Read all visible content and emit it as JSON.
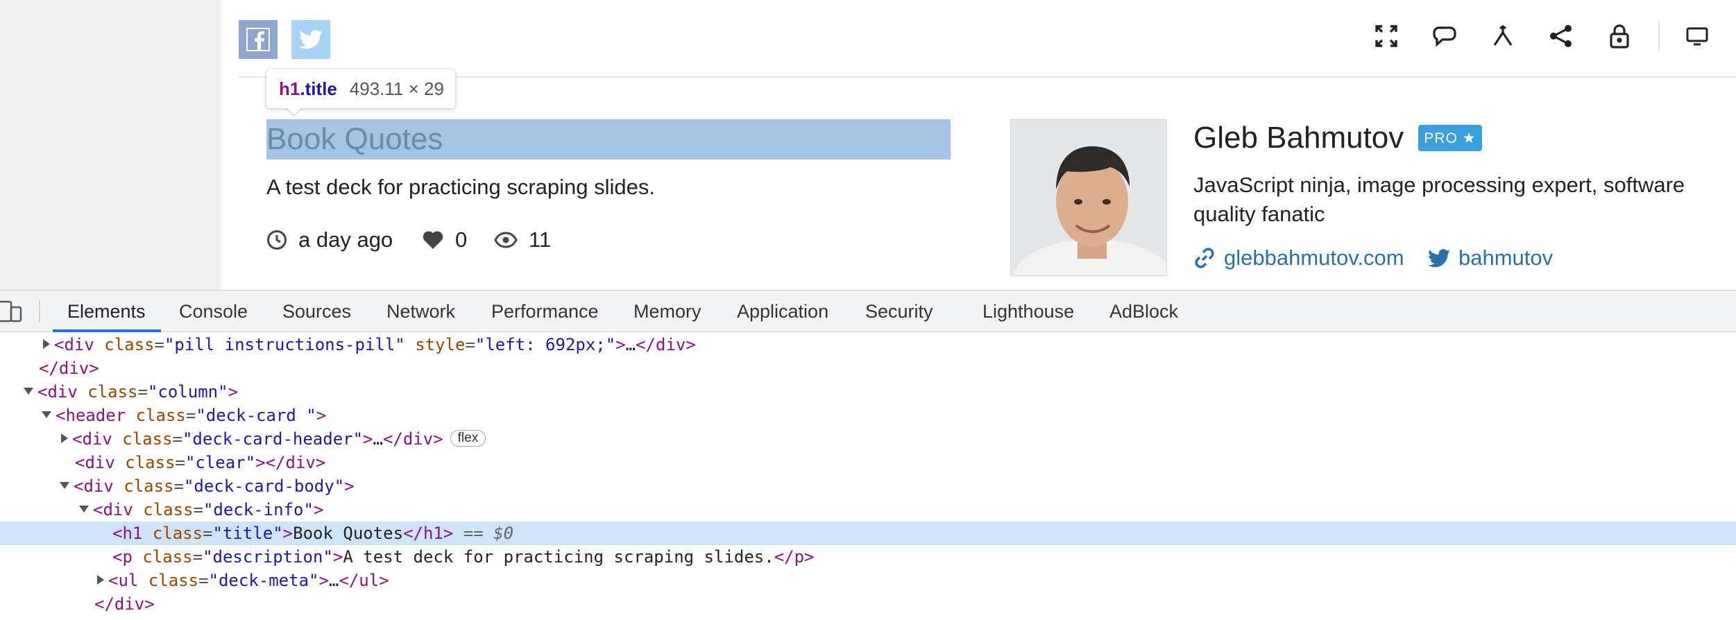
{
  "social": {
    "facebook_icon": "facebook-icon",
    "twitter_icon": "twitter-icon"
  },
  "toolbar": {
    "icons": [
      "fullscreen-icon",
      "comment-icon",
      "fork-icon",
      "share-icon",
      "lock-icon",
      "present-icon"
    ]
  },
  "tooltip": {
    "selector_tag": "h1",
    "selector_class": ".title",
    "dimensions": "493.11 × 29"
  },
  "deck": {
    "title": "Book Quotes",
    "description": "A test deck for practicing scraping slides.",
    "time": "a day ago",
    "likes": "0",
    "views": "11"
  },
  "author": {
    "name": "Gleb Bahmutov",
    "badge": "PRO ★",
    "bio": "JavaScript ninja, image processing expert, software quality fanatic",
    "website": "glebbahmutov.com",
    "twitter": "bahmutov"
  },
  "devtools": {
    "tabs": [
      "Elements",
      "Console",
      "Sources",
      "Network",
      "Performance",
      "Memory",
      "Application",
      "Security",
      "Lighthouse",
      "AdBlock"
    ],
    "active_tab": "Elements",
    "lines": [
      {
        "attr1": "class",
        "val1": "pill instructions-pill",
        "attr2": "style",
        "val2": "left: 692px;"
      },
      {
        "close": "</div>"
      },
      {
        "open": "<div",
        "attr": "class",
        "val": "column"
      },
      {
        "open": "<header",
        "attr": "class",
        "val": "deck-card "
      },
      {
        "open": "<div",
        "attr": "class",
        "val": "deck-card-header",
        "badge": "flex"
      },
      {
        "open": "<div",
        "attr": "class",
        "val": "clear",
        "close": "</div>"
      },
      {
        "open": "<div",
        "attr": "class",
        "val": "deck-card-body"
      },
      {
        "open": "<div",
        "attr": "class",
        "val": "deck-info"
      },
      {
        "open": "<h1",
        "attr": "class",
        "val": "title",
        "text": "Book Quotes",
        "close": "</h1>",
        "marker": "== $0"
      },
      {
        "open": "<p",
        "attr": "class",
        "val": "description",
        "text": "A test deck for practicing scraping slides.",
        "close": "</p>"
      },
      {
        "open": "<ul",
        "attr": "class",
        "val": "deck-meta",
        "close": "</ul>"
      },
      {
        "close": "</div>"
      }
    ]
  },
  "colors": {
    "accent": "#1a73e8",
    "selection": "#cfe3f7",
    "title_highlight": "#a5c4e3",
    "pro_badge": "#3aa0d8",
    "link": "#2a6fa8"
  }
}
